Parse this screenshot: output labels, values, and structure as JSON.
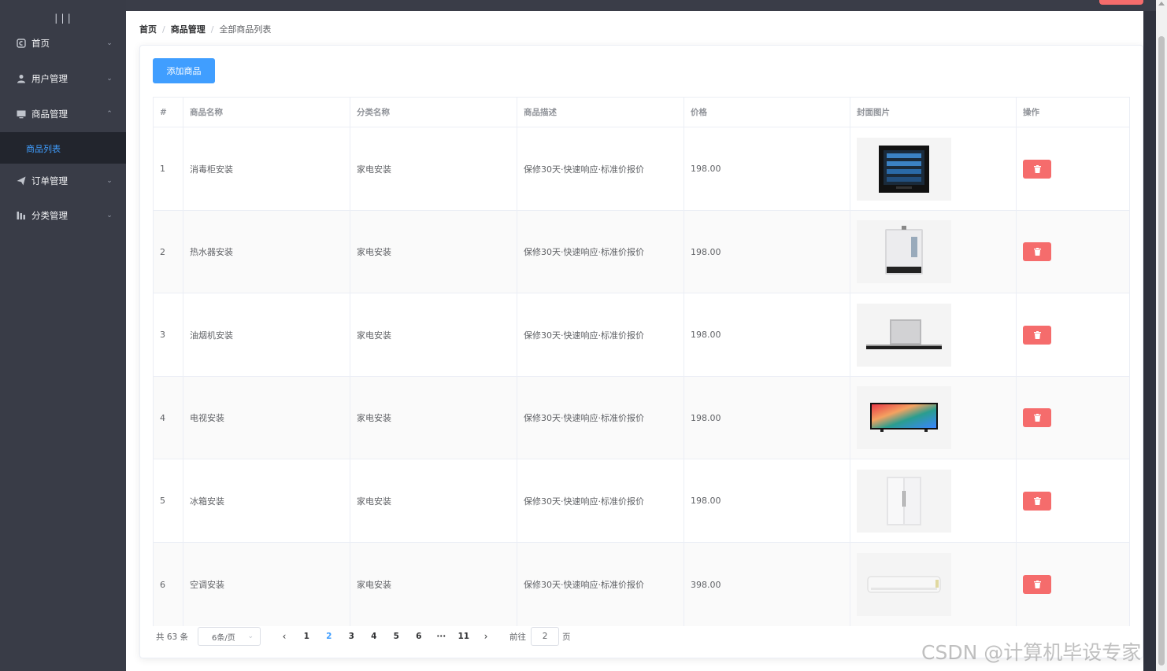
{
  "sidebar": {
    "toggle": "|||",
    "items": [
      {
        "label": "首页",
        "icon": "home-icon",
        "expanded": false
      },
      {
        "label": "用户管理",
        "icon": "user-icon",
        "expanded": false
      },
      {
        "label": "商品管理",
        "icon": "monitor-icon",
        "expanded": true
      },
      {
        "label": "订单管理",
        "icon": "send-icon",
        "expanded": false
      },
      {
        "label": "分类管理",
        "icon": "chart-icon",
        "expanded": false
      }
    ],
    "submenu": {
      "label": "商品列表",
      "active": true
    }
  },
  "breadcrumb": {
    "home": "首页",
    "section": "商品管理",
    "current": "全部商品列表",
    "separator": "/"
  },
  "toolbar": {
    "add_label": "添加商品"
  },
  "table": {
    "columns": [
      "#",
      "商品名称",
      "分类名称",
      "商品描述",
      "价格",
      "封面图片",
      "操作"
    ],
    "rows": [
      {
        "index": "1",
        "name": "消毒柜安装",
        "category": "家电安装",
        "desc": "保修30天·快速响应·标准价报价",
        "price": "198.00",
        "image": "disinfection-cabinet"
      },
      {
        "index": "2",
        "name": "热水器安装",
        "category": "家电安装",
        "desc": "保修30天·快速响应·标准价报价",
        "price": "198.00",
        "image": "water-heater"
      },
      {
        "index": "3",
        "name": "油烟机安装",
        "category": "家电安装",
        "desc": "保修30天·快速响应·标准价报价",
        "price": "198.00",
        "image": "range-hood"
      },
      {
        "index": "4",
        "name": "电视安装",
        "category": "家电安装",
        "desc": "保修30天·快速响应·标准价报价",
        "price": "198.00",
        "image": "television"
      },
      {
        "index": "5",
        "name": "冰箱安装",
        "category": "家电安装",
        "desc": "保修30天·快速响应·标准价报价",
        "price": "198.00",
        "image": "refrigerator"
      },
      {
        "index": "6",
        "name": "空调安装",
        "category": "家电安装",
        "desc": "保修30天·快速响应·标准价报价",
        "price": "398.00",
        "image": "air-conditioner"
      }
    ],
    "delete_icon": "trash-icon"
  },
  "pagination": {
    "total": "共 63 条",
    "page_size": "6条/页",
    "prev": "‹",
    "next": "›",
    "pages": [
      "1",
      "2",
      "3",
      "4",
      "5",
      "6",
      "···",
      "11"
    ],
    "current": "2",
    "goto_label": "前往",
    "goto_value": "2",
    "page_suffix": "页"
  },
  "watermark": "CSDN @计算机毕设专家",
  "colors": {
    "sidebar_bg": "#393c47",
    "accent": "#409eff",
    "danger": "#f56c6c"
  }
}
